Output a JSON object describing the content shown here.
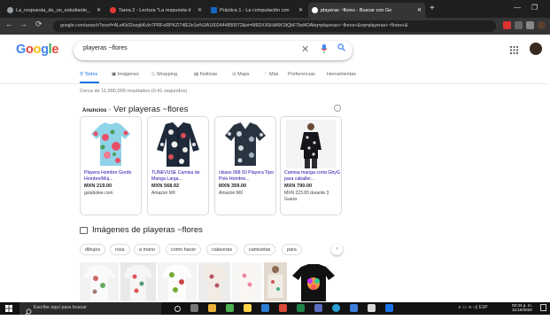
{
  "browser": {
    "tabs": [
      {
        "title": "La_respuesta_de_un_estudiante_",
        "active": false,
        "favicon_color": "#9aa0a6"
      },
      {
        "title": "Tarea 2 - Lectura \"La respuesta d",
        "active": false,
        "favicon_color": "#e53935"
      },
      {
        "title": "Práctica 1 - La computación con",
        "active": false,
        "favicon_color": "#1565c0"
      },
      {
        "title": "playeras ~flores - Buscar con Go",
        "active": true,
        "favicon_color": "#ffffff"
      }
    ],
    "new_tab": "+",
    "window_controls": [
      "—",
      "❐"
    ],
    "url": "google.com/search?sxsrf=ALeKk02ozgkKvIn7PRFoRPKZI74lE3n1w%3A1602444850072&ei=M6DXX5HiA5K3tQbF7bd4OAbq=playeras+~flores+&oq=playeras+~flores+&",
    "nav": [
      "←",
      "→",
      "⟳"
    ]
  },
  "google": {
    "logo": [
      "G",
      "o",
      "o",
      "g",
      "l",
      "e"
    ],
    "logo_colors": [
      "#4285f4",
      "#ea4335",
      "#fbbc05",
      "#4285f4",
      "#34a853",
      "#ea4335"
    ],
    "query": "playeras ~flores",
    "icons": {
      "clear": "close-icon",
      "mic": "mic-icon",
      "search": "search-icon",
      "apps": "apps-grid-icon"
    }
  },
  "search_tabs": [
    {
      "label": "Todos",
      "active": true
    },
    {
      "label": "Imágenes",
      "active": false
    },
    {
      "label": "Shopping",
      "active": false
    },
    {
      "label": "Noticias",
      "active": false
    },
    {
      "label": "Maps",
      "active": false
    },
    {
      "label": "Más",
      "active": false
    },
    {
      "label": "Preferencias",
      "active": false
    },
    {
      "label": "Herramientas",
      "active": false
    }
  ],
  "stats": "Cerca de 11,000,000 resultados (0.41 segundos)",
  "ads": {
    "badge": "Anuncios",
    "heading": "· Ver playeras ~flores",
    "info": "i",
    "products": [
      {
        "title": "Playera Hombre Gordo Hombre/Muj...",
        "price": "MXN 219.00",
        "store": "gulubolee.com"
      },
      {
        "title": "TUNEVUSE Camisa de Manga Larga...",
        "price": "MXN 568.92",
        "store": "Amazon MX"
      },
      {
        "title": "ckiass 068 50 Playera Tipo Polo Hombre...",
        "price": "MXN 359.00",
        "store": "Amazon MX"
      },
      {
        "title": "Camisa manga corta GbyG para caballer...",
        "price": "MXN 790.00",
        "store": "MXN 223.83 durante 3 Guess"
      }
    ]
  },
  "images": {
    "heading": "Imágenes de playeras ~flores",
    "chips": [
      "dibujos",
      "rosa",
      "a mano",
      "como hacer",
      "calaveras",
      "camisetas",
      "para"
    ],
    "chip_next": "›"
  },
  "taskbar": {
    "search_placeholder": "Escribe aquí para buscar",
    "tray": "∧  ▭  ⊲  ◁)  ESP",
    "time": "02:34 p. m.",
    "date": "11/10/2020"
  }
}
